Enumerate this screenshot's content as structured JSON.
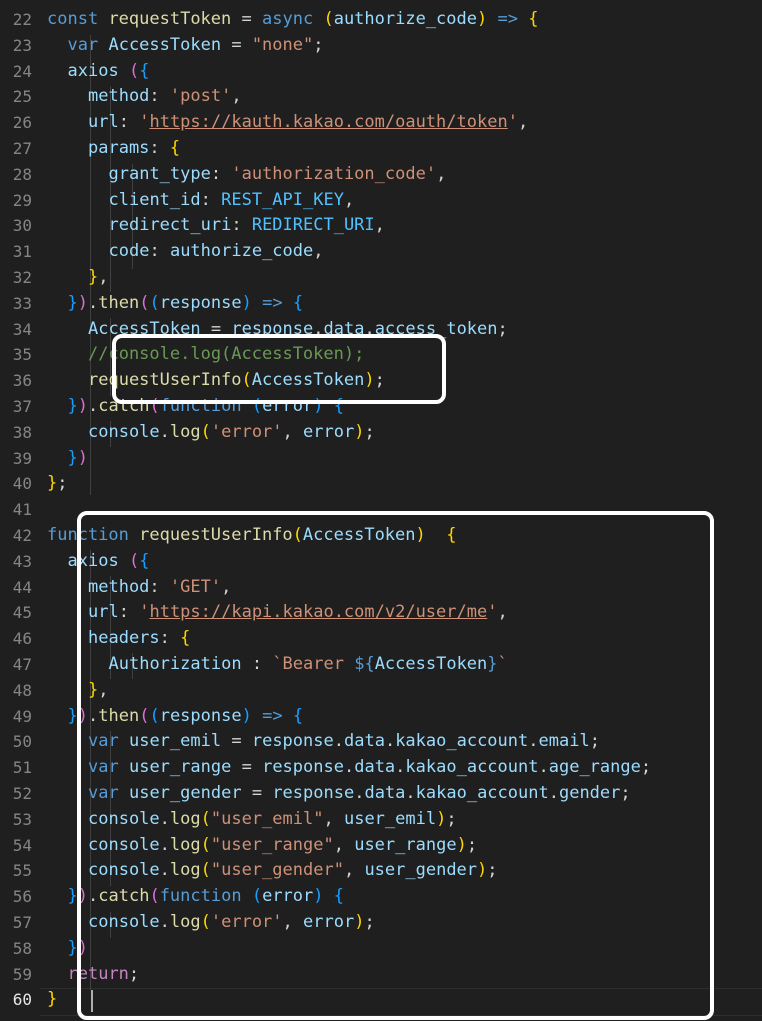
{
  "editor": {
    "current_line": "60",
    "lines": [
      {
        "n": "22",
        "t": "const requestToken = async (authorize_code) => {"
      },
      {
        "n": "23",
        "t": "  var AccessToken = \"none\";"
      },
      {
        "n": "24",
        "t": "  axios ({"
      },
      {
        "n": "25",
        "t": "    method: 'post',"
      },
      {
        "n": "26",
        "t": "    url: 'https://kauth.kakao.com/oauth/token',"
      },
      {
        "n": "27",
        "t": "    params: {"
      },
      {
        "n": "28",
        "t": "      grant_type: 'authorization_code',"
      },
      {
        "n": "29",
        "t": "      client_id: REST_API_KEY,"
      },
      {
        "n": "30",
        "t": "      redirect_uri: REDIRECT_URI,"
      },
      {
        "n": "31",
        "t": "      code: authorize_code,"
      },
      {
        "n": "32",
        "t": "    },"
      },
      {
        "n": "33",
        "t": "  }).then((response) => {"
      },
      {
        "n": "34",
        "t": "    AccessToken = response.data.access_token;"
      },
      {
        "n": "35",
        "t": "    //console.log(AccessToken);"
      },
      {
        "n": "36",
        "t": "    requestUserInfo(AccessToken);"
      },
      {
        "n": "37",
        "t": "  }).catch(function (error) {"
      },
      {
        "n": "38",
        "t": "    console.log('error', error);"
      },
      {
        "n": "39",
        "t": "  })"
      },
      {
        "n": "40",
        "t": "};"
      },
      {
        "n": "41",
        "t": ""
      },
      {
        "n": "42",
        "t": "function requestUserInfo(AccessToken)  {"
      },
      {
        "n": "43",
        "t": "  axios ({"
      },
      {
        "n": "44",
        "t": "    method: 'GET',"
      },
      {
        "n": "45",
        "t": "    url: 'https://kapi.kakao.com/v2/user/me',"
      },
      {
        "n": "46",
        "t": "    headers: {"
      },
      {
        "n": "47",
        "t": "      Authorization : `Bearer ${AccessToken}`"
      },
      {
        "n": "48",
        "t": "    },"
      },
      {
        "n": "49",
        "t": "  }).then((response) => {"
      },
      {
        "n": "50",
        "t": "    var user_emil = response.data.kakao_account.email;"
      },
      {
        "n": "51",
        "t": "    var user_range = response.data.kakao_account.age_range;"
      },
      {
        "n": "52",
        "t": "    var user_gender = response.data.kakao_account.gender;"
      },
      {
        "n": "53",
        "t": "    console.log(\"user_emil\", user_emil);"
      },
      {
        "n": "54",
        "t": "    console.log(\"user_range\", user_range);"
      },
      {
        "n": "55",
        "t": "    console.log(\"user_gender\", user_gender);"
      },
      {
        "n": "56",
        "t": "  }).catch(function (error) {"
      },
      {
        "n": "57",
        "t": "    console.log('error', error);"
      },
      {
        "n": "58",
        "t": "  })"
      },
      {
        "n": "59",
        "t": "  return;"
      },
      {
        "n": "60",
        "t": "}"
      }
    ]
  },
  "colors": {
    "background": "#1f1f1f",
    "keyword": "#569cd6",
    "control": "#c586c0",
    "function": "#dcdcaa",
    "variable": "#9cdcfe",
    "constant": "#4fc1ff",
    "string": "#ce9178",
    "comment": "#6a9955",
    "highlight_box": "#ffffff"
  }
}
